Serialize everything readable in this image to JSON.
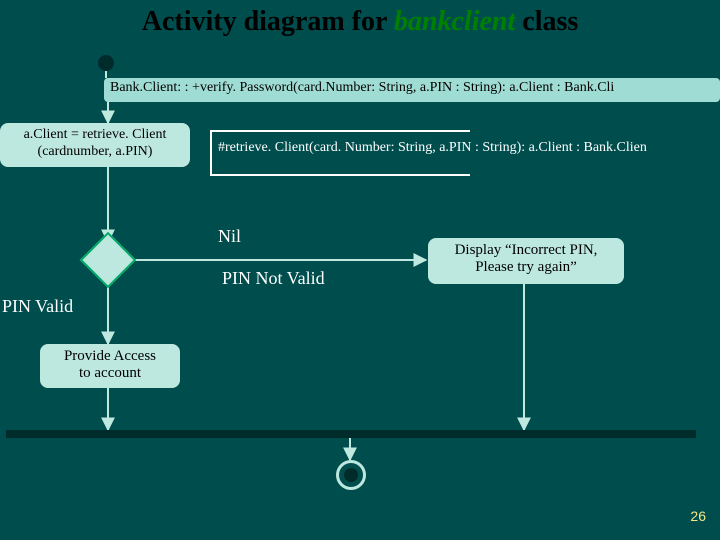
{
  "title": {
    "pre": "Activity diagram for ",
    "em": "bankclient",
    "post": " class"
  },
  "topbox": "Bank.Client: : +verify. Password(card.Number: String, a.PIN : String): a.Client : Bank.Cli",
  "retrievebox": {
    "l1": "a.Client = retrieve. Client",
    "l2": "(cardnumber, a.PIN)"
  },
  "defbox": "#retrieve. Client(card. Number: String, a.PIN : String): a.Client : Bank.Clien",
  "labels": {
    "nil": "Nil",
    "notvalid": "PIN Not Valid",
    "valid": "PIN Valid"
  },
  "incorrect": {
    "l1": "Display “Incorrect PIN,",
    "l2": "Please try again”"
  },
  "access": {
    "l1": "Provide Access",
    "l2": "to account"
  },
  "page": "26"
}
